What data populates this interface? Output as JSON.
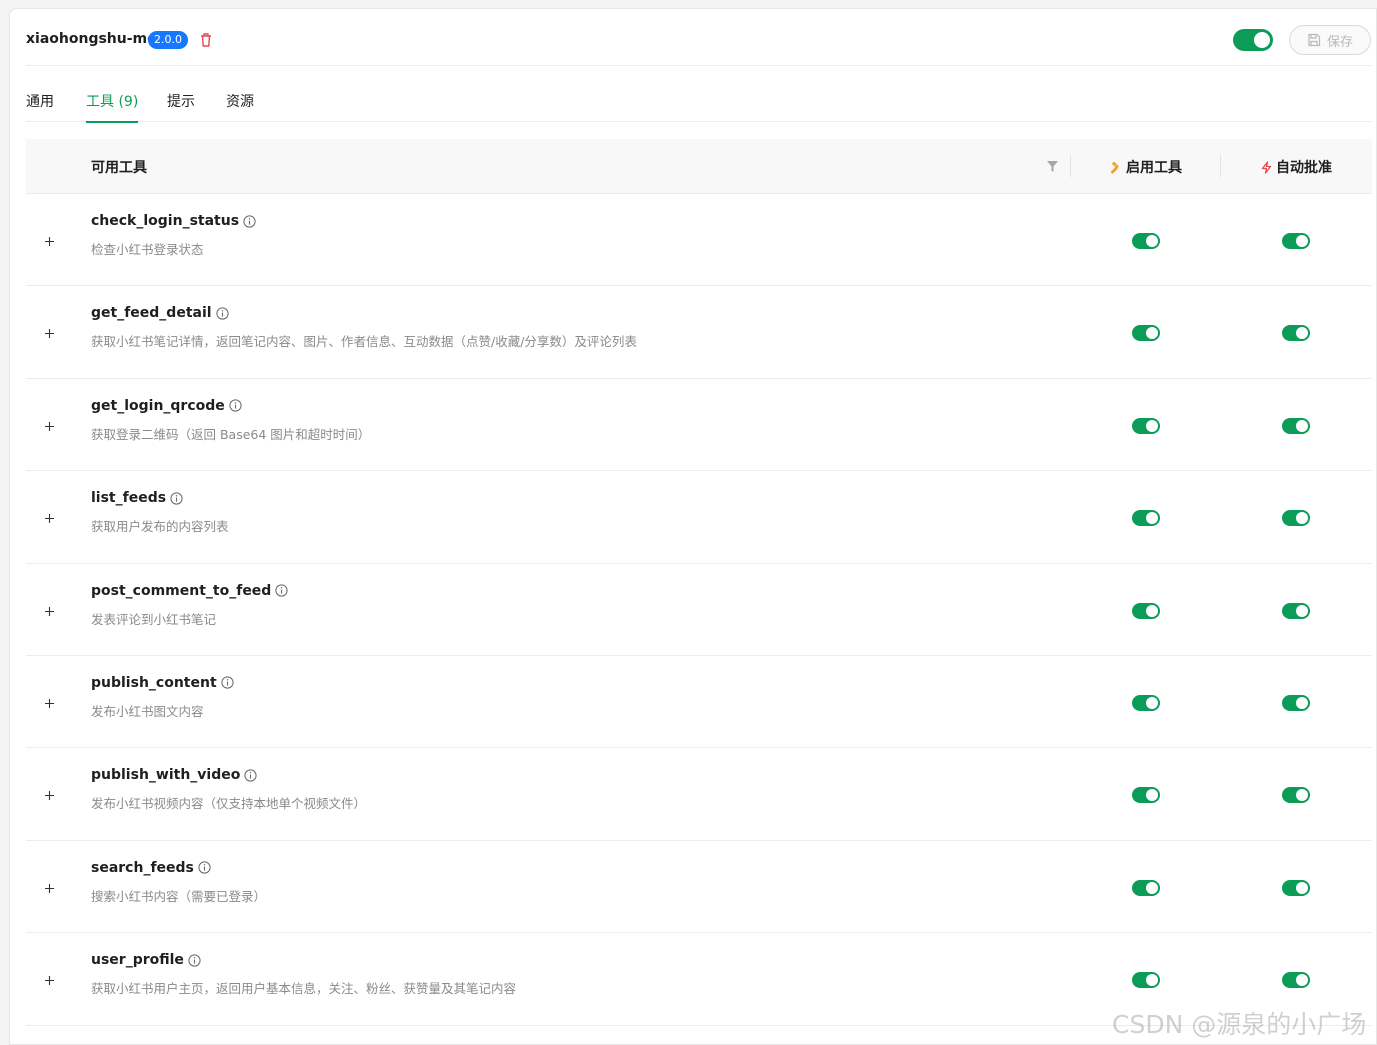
{
  "header": {
    "server_name": "xiaohongshu-mcp",
    "version": "2.0.0",
    "save_label": "保存"
  },
  "tabs": [
    {
      "label": "通用"
    },
    {
      "label": "工具 (9)"
    },
    {
      "label": "提示"
    },
    {
      "label": "资源"
    }
  ],
  "table": {
    "col_tools": "可用工具",
    "col_enable": "启用工具",
    "col_auto": "自动批准"
  },
  "tools": [
    {
      "name": "check_login_status",
      "desc": "检查小红书登录状态",
      "enabled": true,
      "auto_approve": true
    },
    {
      "name": "get_feed_detail",
      "desc": "获取小红书笔记详情，返回笔记内容、图片、作者信息、互动数据（点赞/收藏/分享数）及评论列表",
      "enabled": true,
      "auto_approve": true
    },
    {
      "name": "get_login_qrcode",
      "desc": "获取登录二维码（返回 Base64 图片和超时时间）",
      "enabled": true,
      "auto_approve": true
    },
    {
      "name": "list_feeds",
      "desc": "获取用户发布的内容列表",
      "enabled": true,
      "auto_approve": true
    },
    {
      "name": "post_comment_to_feed",
      "desc": "发表评论到小红书笔记",
      "enabled": true,
      "auto_approve": true
    },
    {
      "name": "publish_content",
      "desc": "发布小红书图文内容",
      "enabled": true,
      "auto_approve": true
    },
    {
      "name": "publish_with_video",
      "desc": "发布小红书视频内容（仅支持本地单个视频文件）",
      "enabled": true,
      "auto_approve": true
    },
    {
      "name": "search_feeds",
      "desc": "搜索小红书内容（需要已登录）",
      "enabled": true,
      "auto_approve": true
    },
    {
      "name": "user_profile",
      "desc": "获取小红书用户主页，返回用户基本信息，关注、粉丝、获赞量及其笔记内容",
      "enabled": true,
      "auto_approve": true
    }
  ],
  "watermark": "CSDN @源泉的小广场",
  "colors": {
    "accent": "#0b9d58",
    "version_badge": "#1677ff",
    "delete": "#e5484d",
    "enable_icon": "#f0a020",
    "auto_icon": "#e5484d"
  }
}
